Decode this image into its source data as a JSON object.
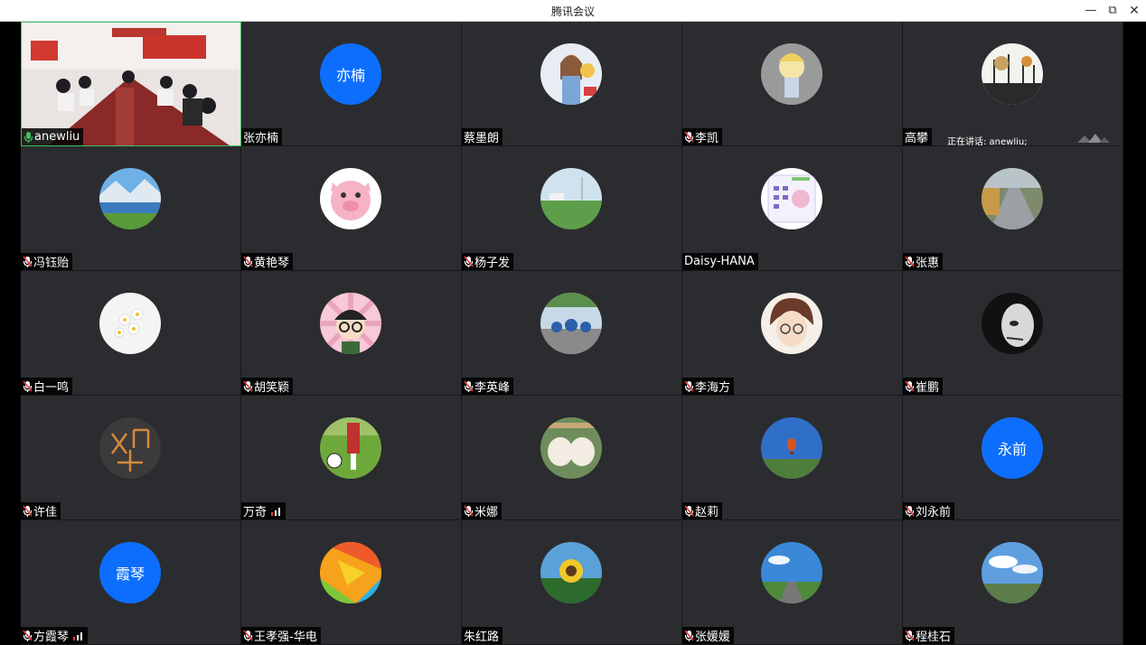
{
  "window": {
    "title": "腾讯会议",
    "minimize": "—",
    "maximize": "⧉",
    "close": "✕"
  },
  "speaking_indicator": "正在讲话: anewliu;",
  "accent": "#0d6efd",
  "active_border": "#3fbf5a",
  "participants": [
    {
      "name": "anewliu",
      "mic": "active",
      "avatar": "video"
    },
    {
      "name": "张亦楠",
      "mic": "none",
      "avatar": "text",
      "avatar_text": "亦楠"
    },
    {
      "name": "蔡墨朗",
      "mic": "none",
      "avatar": "girl-portrait"
    },
    {
      "name": "李凯",
      "mic": "muted",
      "avatar": "cartoon-boy"
    },
    {
      "name": "高攀",
      "mic": "none",
      "avatar": "winter-trees"
    },
    {
      "name": "冯钰贻",
      "mic": "muted",
      "avatar": "mountain-lake"
    },
    {
      "name": "黄艳琴",
      "mic": "muted",
      "avatar": "pink-pig"
    },
    {
      "name": "杨子发",
      "mic": "muted",
      "avatar": "green-field"
    },
    {
      "name": "Daisy-HANA",
      "mic": "none",
      "avatar": "calendar"
    },
    {
      "name": "张惠",
      "mic": "muted",
      "avatar": "country-road"
    },
    {
      "name": "白一鸣",
      "mic": "muted",
      "avatar": "daisies"
    },
    {
      "name": "胡笑颖",
      "mic": "muted",
      "avatar": "glasses-girl"
    },
    {
      "name": "李英峰",
      "mic": "muted",
      "avatar": "crowd"
    },
    {
      "name": "李海方",
      "mic": "muted",
      "avatar": "anime-boy"
    },
    {
      "name": "崔鹏",
      "mic": "muted",
      "avatar": "bw-face"
    },
    {
      "name": "许佳",
      "mic": "muted",
      "avatar": "matchsticks"
    },
    {
      "name": "万奇",
      "mic": "none",
      "signal": true,
      "avatar": "soccer"
    },
    {
      "name": "米娜",
      "mic": "muted",
      "avatar": "sheep"
    },
    {
      "name": "赵莉",
      "mic": "muted",
      "avatar": "balloon"
    },
    {
      "name": "刘永前",
      "mic": "muted",
      "avatar": "text",
      "avatar_text": "永前"
    },
    {
      "name": "方霞琴",
      "mic": "muted",
      "signal": true,
      "avatar": "text",
      "avatar_text": "霞琴"
    },
    {
      "name": "王孝强-华电",
      "mic": "muted",
      "avatar": "color-swirl"
    },
    {
      "name": "朱红路",
      "mic": "none",
      "avatar": "sunflower"
    },
    {
      "name": "张媛媛",
      "mic": "muted",
      "avatar": "blue-sky-road"
    },
    {
      "name": "程桂石",
      "mic": "muted",
      "avatar": "sky-landscape"
    }
  ]
}
